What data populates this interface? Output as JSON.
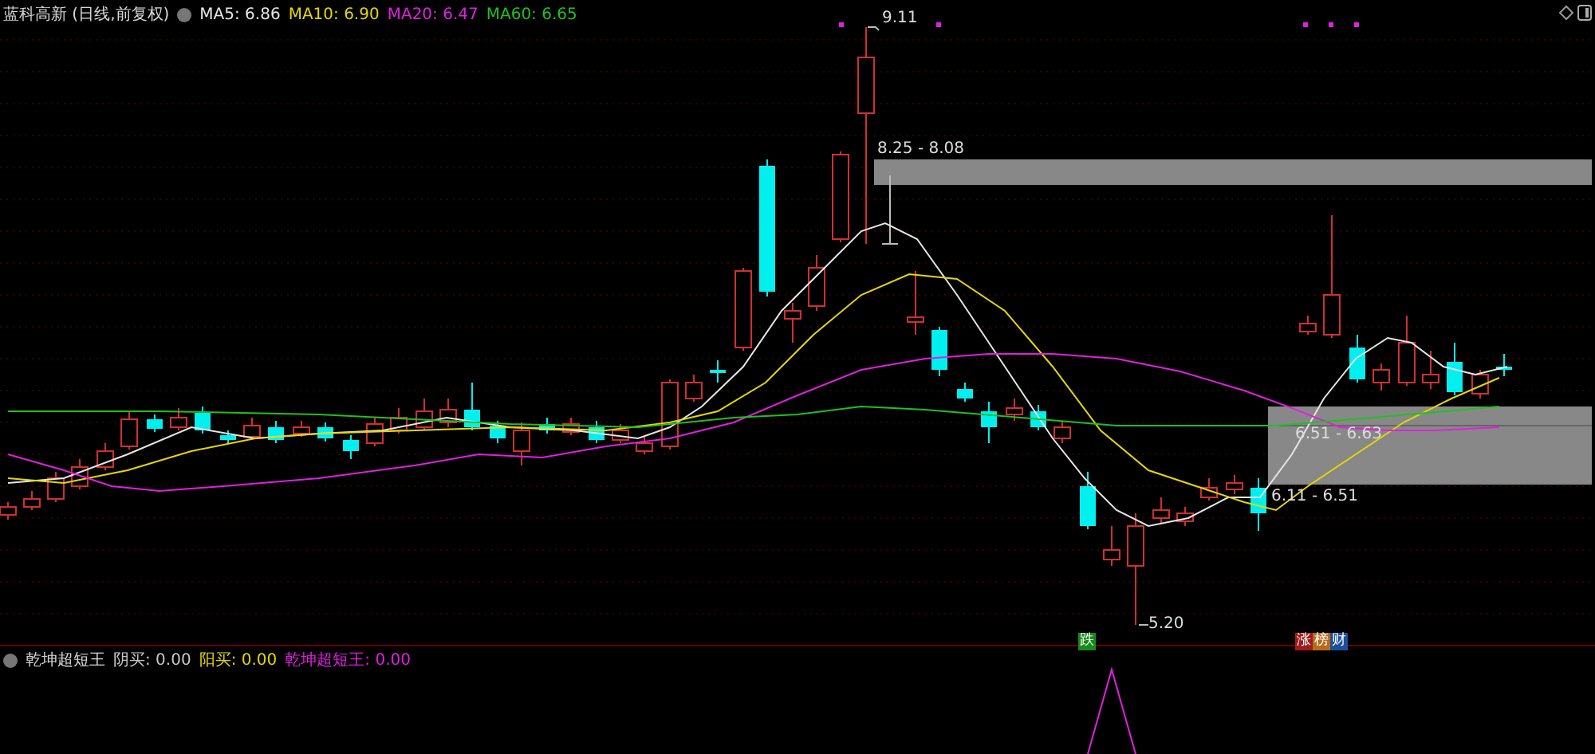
{
  "header": {
    "title": "蓝科高新 (日线,前复权)",
    "indicators": [
      {
        "label": "MA5: 6.86",
        "color": "#e6e6e6"
      },
      {
        "label": "MA10: 6.90",
        "color": "#e6d800"
      },
      {
        "label": "MA20: 6.47",
        "color": "#e020e0"
      },
      {
        "label": "MA60: 6.65",
        "color": "#20c020"
      }
    ]
  },
  "chart": {
    "zones": [
      {
        "label": "8.25 - 8.08"
      },
      {
        "label": "6.51 - 6.63"
      },
      {
        "label": "6.11 - 6.51"
      }
    ],
    "price_marks": [
      {
        "label": "9.11"
      },
      {
        "label": "5.20"
      }
    ],
    "signals": [
      {
        "label": "跌",
        "color": "#1a8a1a"
      },
      {
        "label": "涨",
        "color": "#a01c1c"
      },
      {
        "label": "榜",
        "color": "#b86a1c"
      },
      {
        "label": "财",
        "color": "#1f4f9a"
      }
    ]
  },
  "sub_chart": {
    "title": "乾坤超短王",
    "values": [
      {
        "label": "阴买: 0.00",
        "color": "#c8c8c8"
      },
      {
        "label": "阳买: 0.00",
        "color": "#e6d800"
      },
      {
        "label": "乾坤超短王: 0.00",
        "color": "#e020e0"
      }
    ]
  }
}
